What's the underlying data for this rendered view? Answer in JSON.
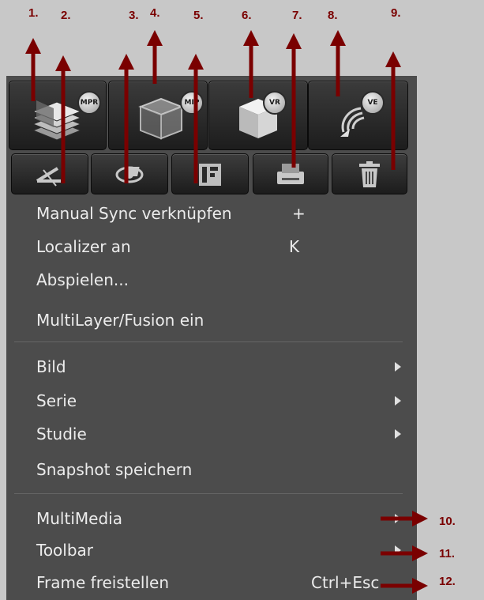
{
  "annotations": [
    "1.",
    "2.",
    "3.",
    "4.",
    "5.",
    "6.",
    "7.",
    "8.",
    "9.",
    "10.",
    "11.",
    "12."
  ],
  "mode_buttons": [
    {
      "icon": "mpr-icon",
      "badge": "MPR"
    },
    {
      "icon": "mip-icon",
      "badge": "MIP"
    },
    {
      "icon": "vr-icon",
      "badge": "VR"
    },
    {
      "icon": "ve-icon",
      "badge": "VE"
    }
  ],
  "tool_buttons": [
    {
      "icon": "angle-measure-icon"
    },
    {
      "icon": "eye-icon"
    },
    {
      "icon": "frame-layout-icon"
    },
    {
      "icon": "printer-icon"
    },
    {
      "icon": "trash-icon"
    }
  ],
  "menu": {
    "group1": [
      {
        "label": "Manual Sync verknüpfen",
        "shortcut": "+"
      },
      {
        "label": "Localizer an",
        "shortcut": "K"
      },
      {
        "label": "Abspielen...",
        "shortcut": ""
      },
      {
        "label": "MultiLayer/Fusion ein",
        "shortcut": ""
      }
    ],
    "group2": [
      {
        "label": "Bild",
        "submenu": true
      },
      {
        "label": "Serie",
        "submenu": true
      },
      {
        "label": "Studie",
        "submenu": true
      },
      {
        "label": "Snapshot speichern",
        "submenu": false
      }
    ],
    "group3": [
      {
        "label": "MultiMedia",
        "shortcut": "",
        "submenu": true
      },
      {
        "label": "Toolbar",
        "shortcut": "",
        "submenu": true
      },
      {
        "label": "Frame freistellen",
        "shortcut": "Ctrl+Esc",
        "submenu": false
      }
    ]
  },
  "colors": {
    "menu_bg": "#4c4c4c",
    "annotation": "#7a0000",
    "page_bg": "#c8c8c8"
  }
}
